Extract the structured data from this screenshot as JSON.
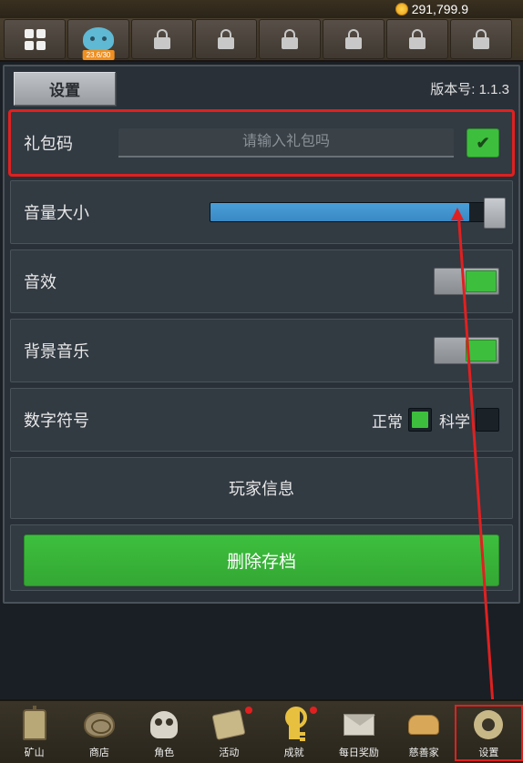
{
  "top": {
    "currency_partial": "291,799.9"
  },
  "tabs": {
    "slime_badge": "23.6/30"
  },
  "panel": {
    "title": "设置",
    "version_label": "版本号:",
    "version_value": "1.1.3"
  },
  "settings": {
    "gift_label": "礼包码",
    "gift_placeholder": "请输入礼包吗",
    "volume_label": "音量大小",
    "volume_value": 90,
    "sfx_label": "音效",
    "sfx_on": true,
    "bgm_label": "背景音乐",
    "bgm_on": true,
    "notation_label": "数字符号",
    "notation_normal": "正常",
    "notation_sci": "科学",
    "notation_selected": "normal",
    "player_info": "玩家信息",
    "delete_label": "删除存档"
  },
  "nav": {
    "items": [
      {
        "label": "矿山",
        "icon": "lantern"
      },
      {
        "label": "商店",
        "icon": "fossil"
      },
      {
        "label": "角色",
        "icon": "skull"
      },
      {
        "label": "活动",
        "icon": "scroll",
        "notif": true
      },
      {
        "label": "成就",
        "icon": "key",
        "notif": true
      },
      {
        "label": "每日奖励",
        "icon": "envelope"
      },
      {
        "label": "慈善家",
        "icon": "bread"
      },
      {
        "label": "设置",
        "icon": "gear",
        "selected": true
      }
    ]
  }
}
